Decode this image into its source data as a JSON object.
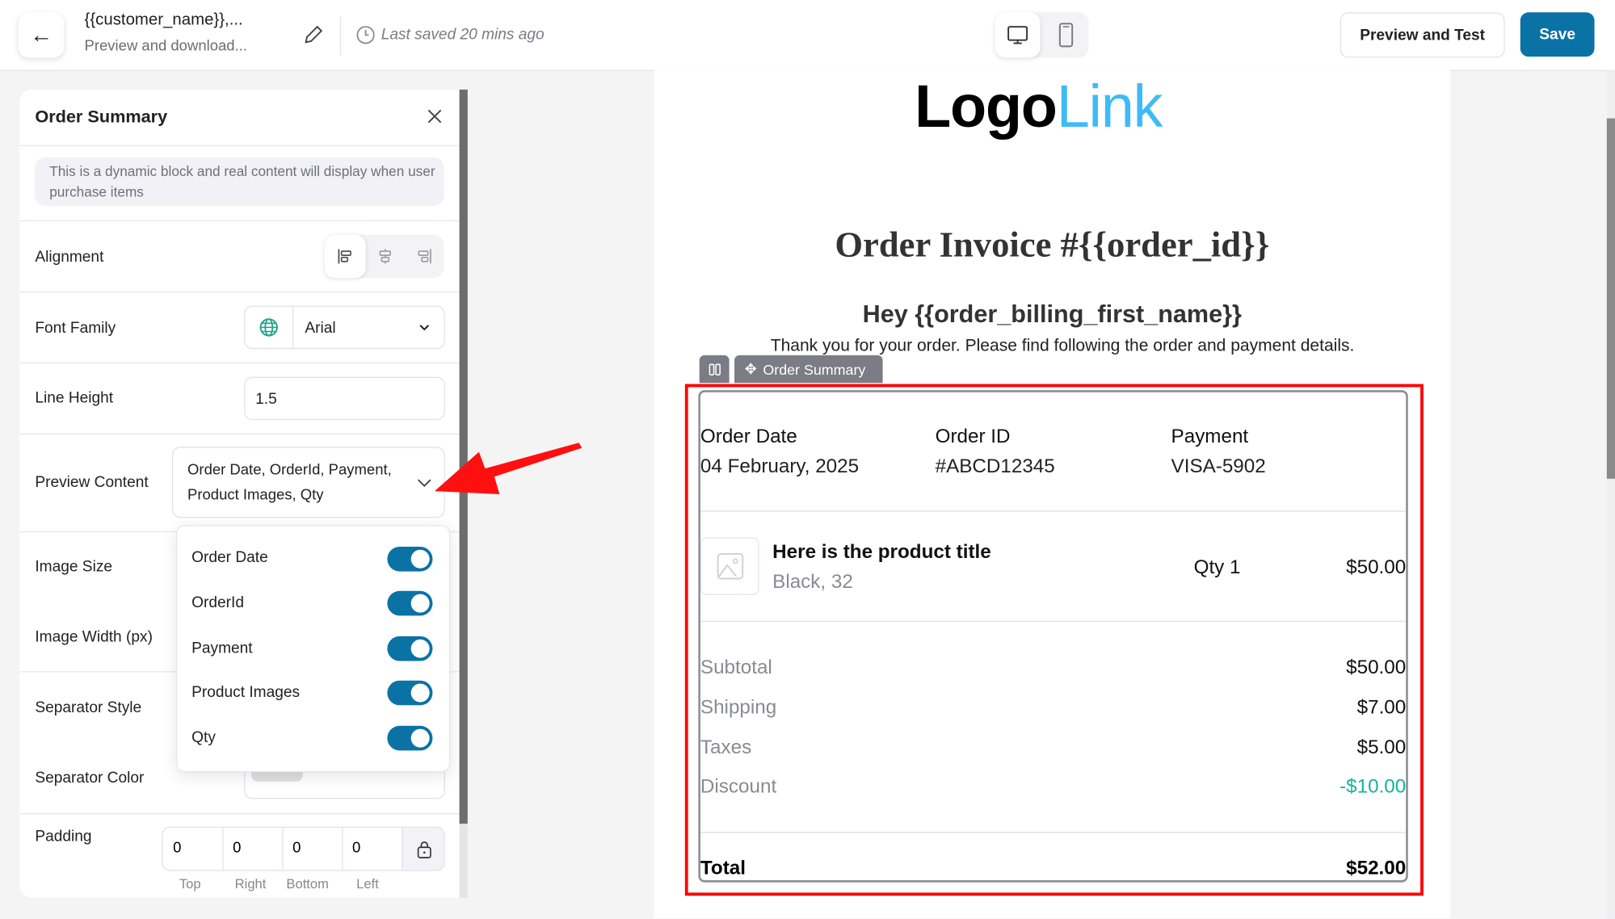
{
  "header": {
    "title": "{{customer_name}},...",
    "subtitle": "Preview and download...",
    "last_saved": "Last saved 20 mins ago",
    "preview_button": "Preview and Test",
    "save_button": "Save",
    "accent_color": "#0b72a6"
  },
  "panel": {
    "title": "Order Summary",
    "info": "This is a dynamic block and real content will display when user purchase items",
    "alignment_label": "Alignment",
    "alignment_selected": "left",
    "font_family_label": "Font Family",
    "font_family_value": "Arial",
    "line_height_label": "Line Height",
    "line_height_value": "1.5",
    "preview_content_label": "Preview Content",
    "preview_content_value": "Order Date, OrderId, Payment, Product Images, Qty",
    "image_size_label": "Image Size",
    "image_width_label": "Image Width (px)",
    "separator_style_label": "Separator Style",
    "separator_color_label": "Separator Color",
    "separator_color_value": "#dfdfdf",
    "padding_label": "Padding",
    "padding": [
      {
        "value": "0",
        "label": "Top"
      },
      {
        "value": "0",
        "label": "Right"
      },
      {
        "value": "0",
        "label": "Bottom"
      },
      {
        "value": "0",
        "label": "Left"
      }
    ],
    "dropdown_options": [
      {
        "label": "Order Date",
        "enabled": true
      },
      {
        "label": "OrderId",
        "enabled": true
      },
      {
        "label": "Payment",
        "enabled": true
      },
      {
        "label": "Product Images",
        "enabled": true
      },
      {
        "label": "Qty",
        "enabled": true
      }
    ]
  },
  "email": {
    "logo_part1": "Logo",
    "logo_part2": "Link",
    "title": "Order Invoice #{{order_id}}",
    "greeting": "Hey {{order_billing_first_name}}",
    "intro": "Thank you for your order. Please find following the order and payment details.",
    "block_tag": "Order Summary",
    "meta": [
      {
        "label": "Order Date",
        "value": "04 February, 2025"
      },
      {
        "label": "Order ID",
        "value": "#ABCD12345"
      },
      {
        "label": "Payment",
        "value": "VISA-5902"
      }
    ],
    "product": {
      "title": "Here is the product title",
      "variant": "Black, 32",
      "qty": "Qty 1",
      "price": "$50.00"
    },
    "totals": [
      {
        "label": "Subtotal",
        "value": "$50.00"
      },
      {
        "label": "Shipping",
        "value": "$7.00"
      },
      {
        "label": "Taxes",
        "value": "$5.00"
      },
      {
        "label": "Discount",
        "value": "-$10.00"
      }
    ],
    "total_label": "Total",
    "total_value": "$52.00",
    "discount_color": "#17b39b",
    "highlight_color": "#ff0000"
  }
}
